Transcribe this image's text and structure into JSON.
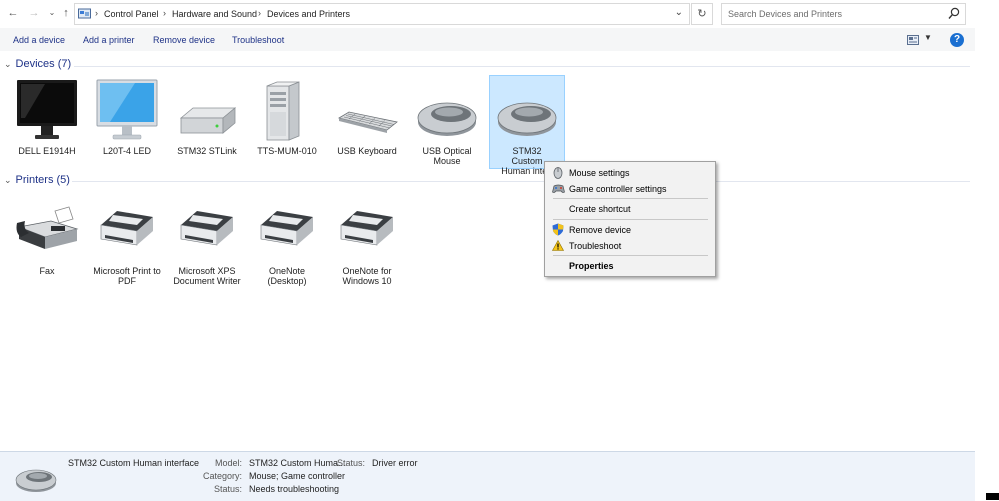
{
  "address": {
    "breadcrumbs": [
      "Control Panel",
      "Hardware and Sound",
      "Devices and Printers"
    ],
    "search_placeholder": "Search Devices and Printers"
  },
  "toolbar": {
    "add_device": "Add a device",
    "add_printer": "Add a printer",
    "remove_device": "Remove device",
    "troubleshoot": "Troubleshoot",
    "help": "?"
  },
  "devices_group": {
    "header": "Devices (7)",
    "items": [
      {
        "label": "DELL E1914H",
        "icon": "monitor-black-icon"
      },
      {
        "label": "L20T-4 LED",
        "icon": "monitor-blue-icon"
      },
      {
        "label": "STM32 STLink",
        "icon": "drive-icon"
      },
      {
        "label": "TTS-MUM-010",
        "icon": "tower-pc-icon"
      },
      {
        "label": "USB Keyboard",
        "icon": "keyboard-icon"
      },
      {
        "label": "USB Optical Mouse",
        "icon": "mouse-icon"
      },
      {
        "label": "STM32 Custom Human interf",
        "icon": "mouse-icon",
        "selected": true
      }
    ]
  },
  "printers_group": {
    "header": "Printers (5)",
    "items": [
      {
        "label": "Fax",
        "icon": "fax-icon"
      },
      {
        "label": "Microsoft Print to PDF",
        "icon": "printer-icon"
      },
      {
        "label": "Microsoft XPS Document Writer",
        "icon": "printer-icon"
      },
      {
        "label": "OneNote (Desktop)",
        "icon": "printer-icon"
      },
      {
        "label": "OneNote for Windows 10",
        "icon": "printer-icon"
      }
    ]
  },
  "context_menu": {
    "items": [
      {
        "label": "Mouse settings",
        "icon": "mouse-small-icon"
      },
      {
        "label": "Game controller settings",
        "icon": "gamepad-icon"
      },
      {
        "label": "Create shortcut"
      },
      {
        "label": "Remove device",
        "icon": "uac-shield-icon"
      },
      {
        "label": "Troubleshoot",
        "icon": "warning-icon"
      },
      {
        "label": "Properties",
        "bold": true
      }
    ]
  },
  "details": {
    "name": "STM32 Custom Human interface",
    "model_label": "Model:",
    "model_value": "STM32 Custom Huma...",
    "category_label": "Category:",
    "category_value": "Mouse; Game controller",
    "status_label": "Status:",
    "status_value": "Needs troubleshooting",
    "status2_label": "Status:",
    "status2_value": "Driver error"
  },
  "colors": {
    "selection_bg": "#cce8ff",
    "link_blue": "#1e3287",
    "details_bg": "#eef3fa"
  }
}
